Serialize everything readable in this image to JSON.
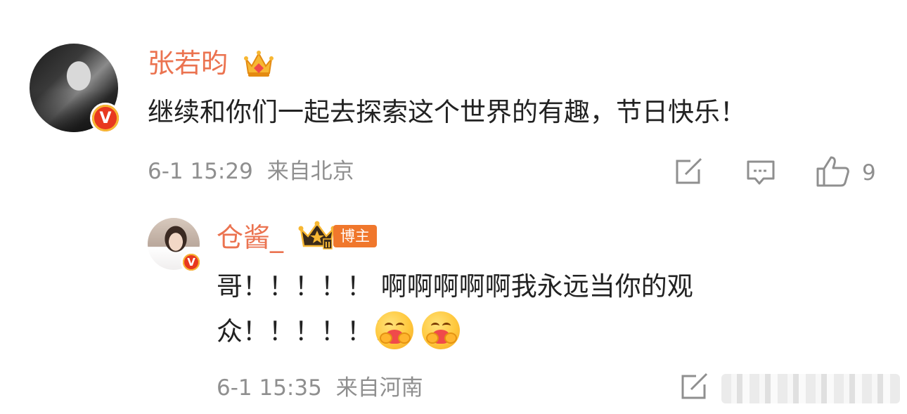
{
  "comment": {
    "username": "张若昀",
    "text": "继续和你们一起去探索这个世界的有趣，节日快乐！",
    "timestamp": "6-1 15:29",
    "location": "来自北京",
    "like_count": "9",
    "verified_badge": "V"
  },
  "reply": {
    "username": "仓酱_",
    "badge_label": "博主",
    "text_line1": "哥！！！！！ 啊啊啊啊啊我永远当你的观",
    "text_line2": "众！！！！！！",
    "timestamp": "6-1 15:35",
    "location": "来自河南",
    "verified_badge": "V",
    "emojis": [
      "hug-emoji",
      "hug-emoji"
    ]
  },
  "colors": {
    "username": "#eb7350",
    "body_text": "#222222",
    "meta_text": "#8f8f8f",
    "blogger_tag": "#f0772c",
    "verified_red": "#e8381f"
  }
}
